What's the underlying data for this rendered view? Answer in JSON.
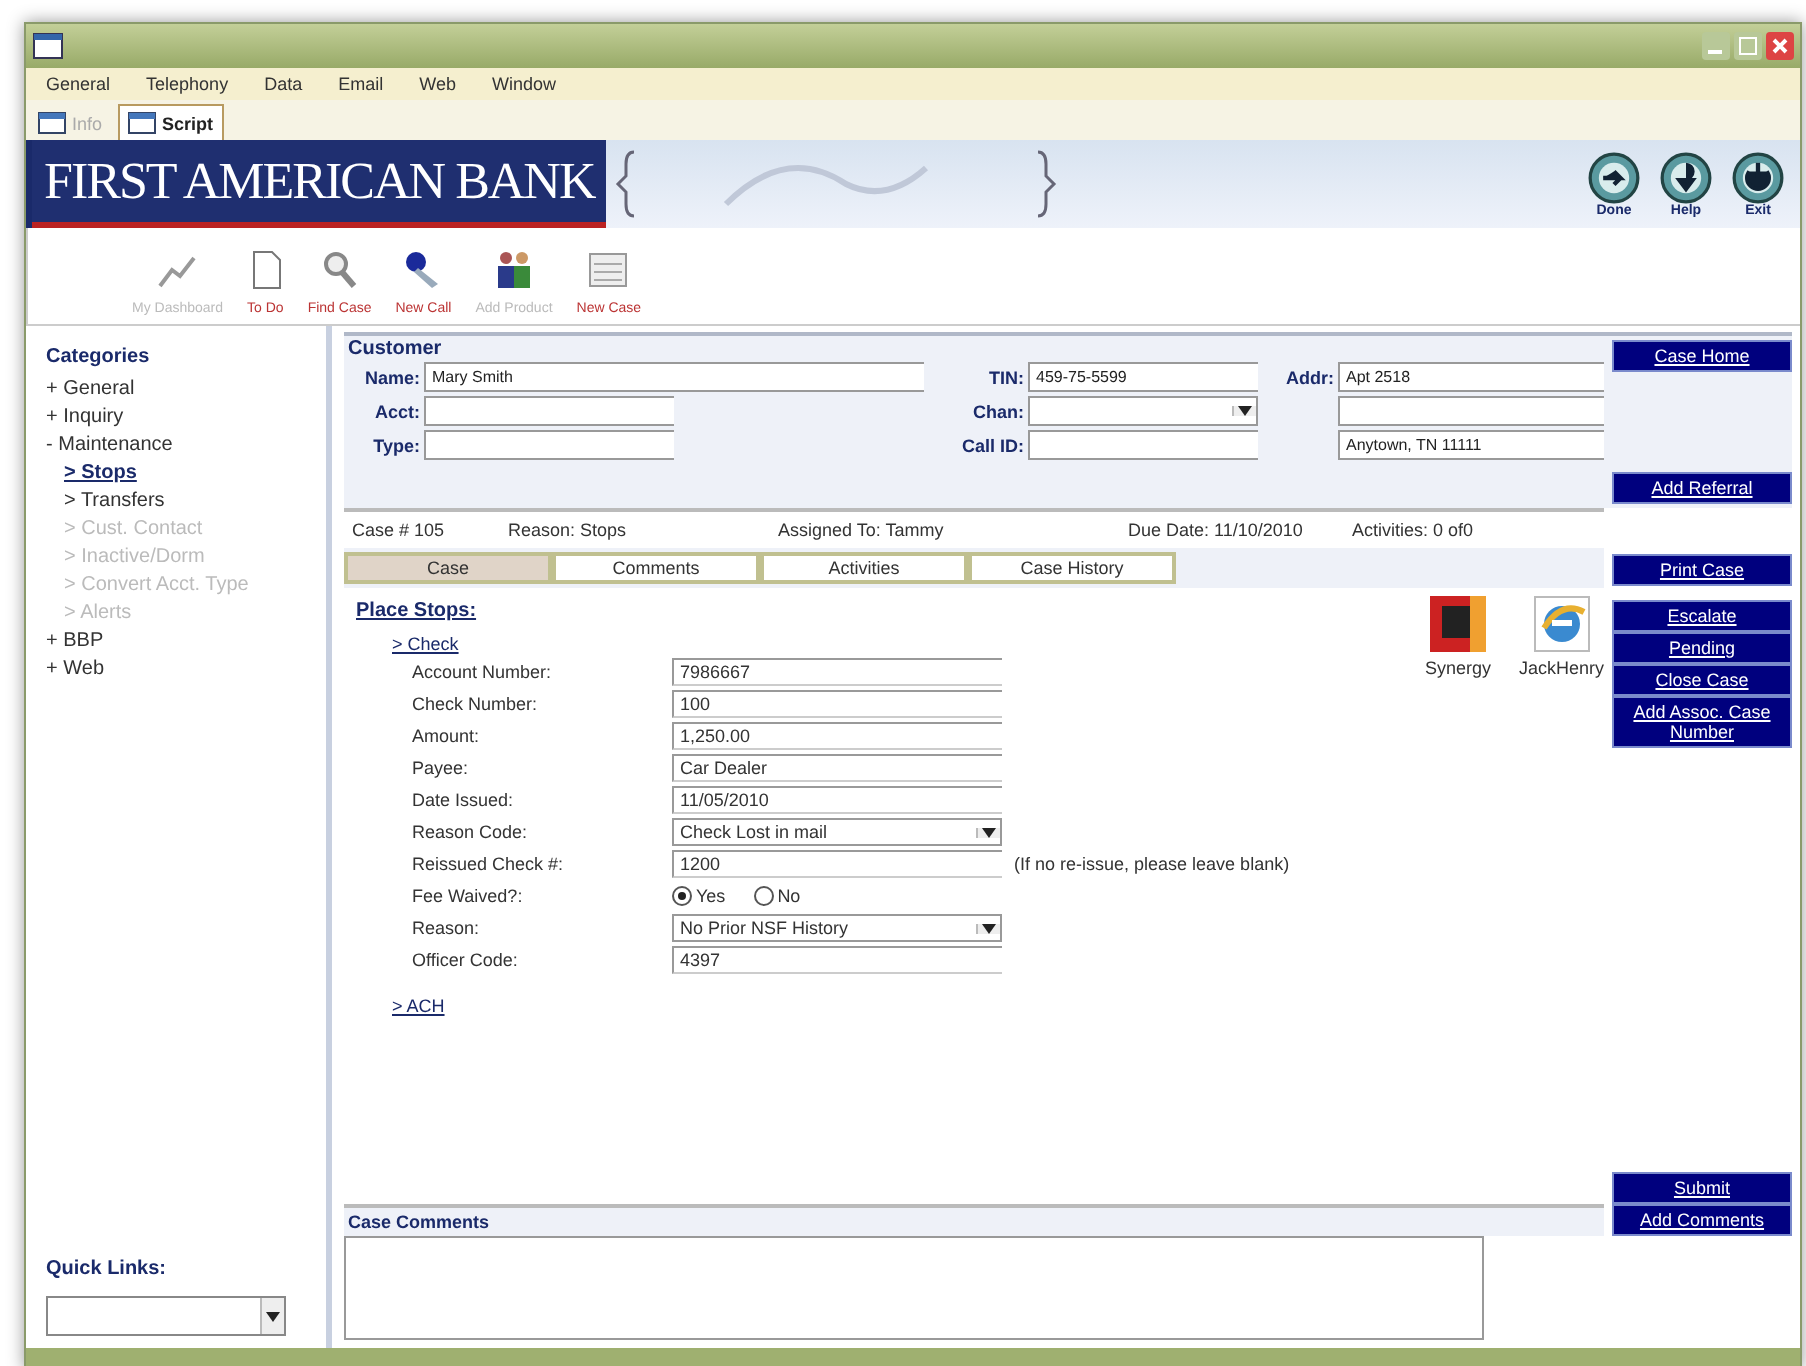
{
  "menu": [
    {
      "label": "General"
    },
    {
      "label": "Telephony"
    },
    {
      "label": "Data"
    },
    {
      "label": "Email"
    },
    {
      "label": "Web"
    },
    {
      "label": "Window"
    }
  ],
  "tabs": [
    {
      "label": "Info",
      "selected": false,
      "disabled": true
    },
    {
      "label": "Script",
      "selected": true,
      "disabled": false
    }
  ],
  "banner": {
    "logo": "FIRST AMERICAN BANK",
    "buttons": [
      {
        "label": "Done"
      },
      {
        "label": "Help"
      },
      {
        "label": "Exit"
      }
    ]
  },
  "toolbar": [
    {
      "label": "My Dashboard",
      "disabled": true
    },
    {
      "label": "To Do",
      "disabled": false
    },
    {
      "label": "Find Case",
      "disabled": false
    },
    {
      "label": "New Call",
      "disabled": false
    },
    {
      "label": "Add Product",
      "disabled": true
    },
    {
      "label": "New Case",
      "disabled": false
    }
  ],
  "sidebar": {
    "title": "Categories",
    "items": [
      {
        "label": "+ General",
        "selected": false,
        "disabled": false
      },
      {
        "label": "+ Inquiry",
        "selected": false,
        "disabled": false
      },
      {
        "label": "- Maintenance",
        "selected": false,
        "disabled": false,
        "children": [
          {
            "label": "> Stops",
            "selected": true,
            "disabled": false
          },
          {
            "label": "> Transfers",
            "selected": false,
            "disabled": false
          },
          {
            "label": "> Cust. Contact",
            "selected": false,
            "disabled": true
          },
          {
            "label": "> Inactive/Dorm",
            "selected": false,
            "disabled": true
          },
          {
            "label": "> Convert Acct. Type",
            "selected": false,
            "disabled": true
          },
          {
            "label": "> Alerts",
            "selected": false,
            "disabled": true
          }
        ]
      },
      {
        "label": "+ BBP",
        "selected": false,
        "disabled": false
      },
      {
        "label": "+ Web",
        "selected": false,
        "disabled": false
      }
    ],
    "quick_links": {
      "label": "Quick Links:"
    }
  },
  "customer": {
    "title": "Customer",
    "name": {
      "label": "Name:",
      "value": "Mary Smith"
    },
    "acct": {
      "label": "Acct:"
    },
    "type": {
      "label": "Type:"
    },
    "tin": {
      "label": "TIN:",
      "value": "459-75-5599"
    },
    "chan": {
      "label": "Chan:"
    },
    "call_id": {
      "label": "Call ID:"
    },
    "addr": {
      "label": "Addr:",
      "street": "Apt 2518",
      "city": "Anytown, TN 11111"
    }
  },
  "case_info": {
    "case_number": "Case # 105",
    "reason": "Reason: Stops",
    "assigned": "Assigned To: Tammy",
    "due": "Due Date: 11/10/2010",
    "activities": "Activities: 0  of0"
  },
  "case_tabs": [
    {
      "label": "Case",
      "selected": true
    },
    {
      "label": "Comments",
      "selected": false
    },
    {
      "label": "Activities",
      "selected": false
    },
    {
      "label": "Case History",
      "selected": false
    }
  ],
  "form": {
    "title": "Place Stops:",
    "section": "> Check",
    "fields": [
      {
        "label": "Account Number:",
        "kind": "text",
        "value": "7986667"
      },
      {
        "label": "Check Number:",
        "kind": "text",
        "value": "100"
      },
      {
        "label": "Amount:",
        "kind": "text",
        "value": "1,250.00"
      },
      {
        "label": "Payee:",
        "kind": "text",
        "value": "Car Dealer"
      },
      {
        "label": "Date Issued:",
        "kind": "text",
        "value": "11/05/2010"
      },
      {
        "label": "Reason Code:",
        "kind": "select",
        "value": "Check Lost in mail"
      },
      {
        "label": "Reissued Check #:",
        "kind": "text",
        "value": "1200",
        "note": "(If no re-issue, please leave blank)"
      },
      {
        "label": "Fee Waived?:",
        "kind": "radio",
        "options": [
          {
            "label": "Yes",
            "selected": true
          },
          {
            "label": "No",
            "selected": false
          }
        ]
      },
      {
        "label": "Reason:",
        "kind": "select",
        "value": "No Prior NSF History"
      },
      {
        "label": "Officer Code:",
        "kind": "text",
        "value": "4397"
      }
    ],
    "next_section": "> ACH"
  },
  "apps": [
    {
      "label": "Synergy"
    },
    {
      "label": "JackHenry"
    }
  ],
  "buttons": {
    "case_home": "Case Home",
    "add_referral": "Add Referral",
    "print_case": "Print Case",
    "actions": [
      "Escalate",
      "Pending",
      "Close Case",
      "Add Assoc. Case Number"
    ],
    "submit": "Submit",
    "add_comments": "Add Comments"
  },
  "comments": {
    "title": "Case Comments"
  }
}
